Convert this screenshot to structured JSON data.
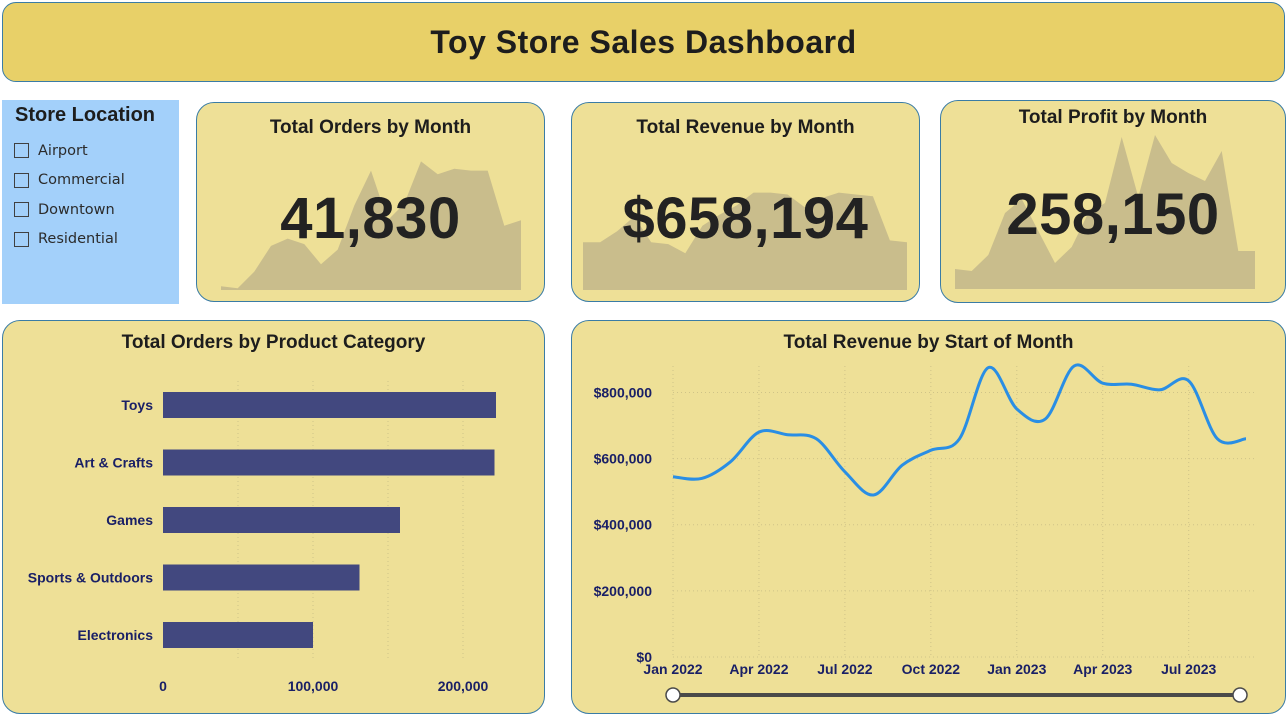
{
  "header": {
    "title": "Toy Store Sales Dashboard"
  },
  "slicer": {
    "title": "Store Location",
    "items": [
      {
        "label": "Airport",
        "checked": false
      },
      {
        "label": "Commercial",
        "checked": false
      },
      {
        "label": "Downtown",
        "checked": false
      },
      {
        "label": "Residential",
        "checked": false
      }
    ]
  },
  "kpis": {
    "orders": {
      "title": "Total Orders by Month",
      "value": "41,830",
      "sparkline": [
        2,
        1,
        10,
        24,
        28,
        25,
        14,
        22,
        46,
        65,
        38,
        47,
        70,
        63,
        66,
        65,
        65,
        35,
        38
      ]
    },
    "revenue": {
      "title": "Total Revenue by Month",
      "value": "$658,194",
      "sparkline": [
        26,
        26,
        32,
        40,
        26,
        25,
        20,
        35,
        41,
        46,
        53,
        53,
        52,
        45,
        50,
        53,
        52,
        51,
        27,
        26
      ]
    },
    "profit": {
      "title": "Total Profit by Month",
      "value": "258,150",
      "sparkline": [
        10,
        9,
        17,
        38,
        45,
        29,
        13,
        21,
        38,
        43,
        76,
        46,
        77,
        63,
        58,
        54,
        69,
        19,
        19
      ]
    }
  },
  "colors": {
    "header_bg": "#e8d068",
    "card_bg": "#eee097",
    "card_border": "#3a7ca5",
    "slicer_bg": "#a3d0fa",
    "spark_fill": "#c9bd8c",
    "bar_fill": "#42487f",
    "axis_text": "#1a2066",
    "line_stroke": "#2a8ee4"
  },
  "chart_data": [
    {
      "type": "bar",
      "orientation": "horizontal",
      "title": "Total Orders by Product Category",
      "categories": [
        "Toys",
        "Art & Crafts",
        "Games",
        "Sports & Outdoors",
        "Electronics"
      ],
      "values": [
        222000,
        221000,
        158000,
        131000,
        100000
      ],
      "xlim": [
        0,
        240000
      ],
      "xticks": [
        0,
        100000,
        200000
      ],
      "xtick_labels": [
        "0",
        "100,000",
        "200,000"
      ],
      "grid": true
    },
    {
      "type": "line",
      "title": "Total Revenue by Start of Month",
      "x": [
        "Jan 2022",
        "Feb 2022",
        "Mar 2022",
        "Apr 2022",
        "May 2022",
        "Jun 2022",
        "Jul 2022",
        "Aug 2022",
        "Sep 2022",
        "Oct 2022",
        "Nov 2022",
        "Dec 2022",
        "Jan 2023",
        "Feb 2023",
        "Mar 2023",
        "Apr 2023",
        "May 2023",
        "Jun 2023",
        "Jul 2023",
        "Aug 2023",
        "Sep 2023"
      ],
      "values": [
        545000,
        540000,
        590000,
        680000,
        672000,
        660000,
        560000,
        490000,
        580000,
        625000,
        660000,
        875000,
        750000,
        720000,
        880000,
        828000,
        825000,
        808000,
        835000,
        660000,
        660000
      ],
      "ylim": [
        0,
        880000
      ],
      "yticks": [
        0,
        200000,
        400000,
        600000,
        800000
      ],
      "ytick_labels": [
        "$0",
        "$200,000",
        "$400,000",
        "$600,000",
        "$800,000"
      ],
      "xtick_labels": [
        "Jan 2022",
        "Apr 2022",
        "Jul 2022",
        "Oct 2022",
        "Jan 2023",
        "Apr 2023",
        "Jul 2023"
      ],
      "grid": true,
      "range_slider": {
        "start": "Jan 2022",
        "end": "Sep 2023"
      }
    }
  ]
}
